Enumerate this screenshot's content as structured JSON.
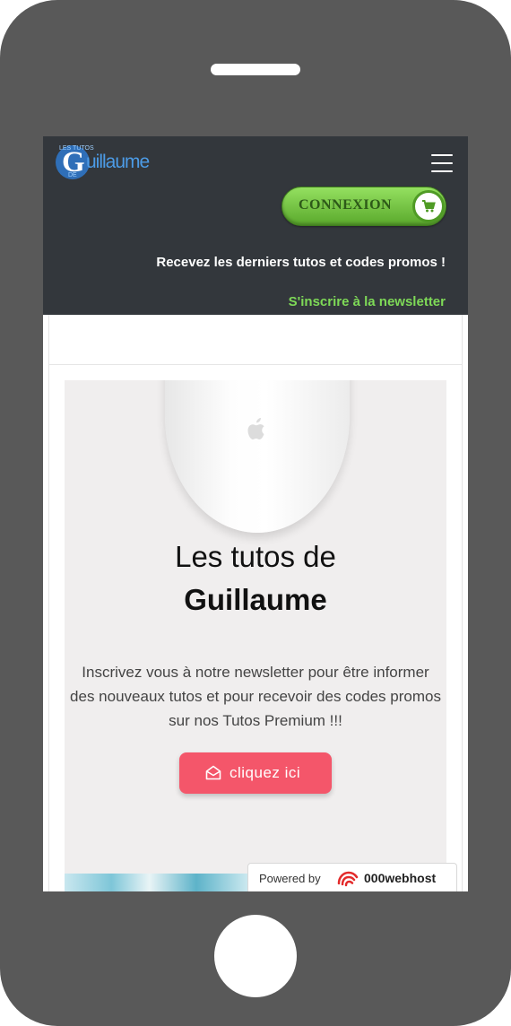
{
  "header": {
    "logo": {
      "letter": "G",
      "wordmark": "uillaume",
      "small_top": "LES TUTOS",
      "small_bottom": "DE"
    },
    "login_button": "CONNEXION",
    "tagline": "Recevez les derniers tutos et codes promos !",
    "newsletter_link": "S'inscrire à la newsletter"
  },
  "hero": {
    "title_line1": "Les tutos de",
    "title_line2": "Guillaume",
    "text": "Inscrivez vous à notre newsletter pour être informer des nouveaux tutos et pour recevoir des codes promos sur nos Tutos Premium !!!",
    "cta_label": "cliquez ici"
  },
  "footer_badge": {
    "powered_by": "Powered by",
    "brand": "000webhost"
  },
  "colors": {
    "header_bg": "#33373c",
    "link_green": "#7ed957",
    "cta_bg": "#f4566a",
    "button_green": "#6cc13a"
  }
}
